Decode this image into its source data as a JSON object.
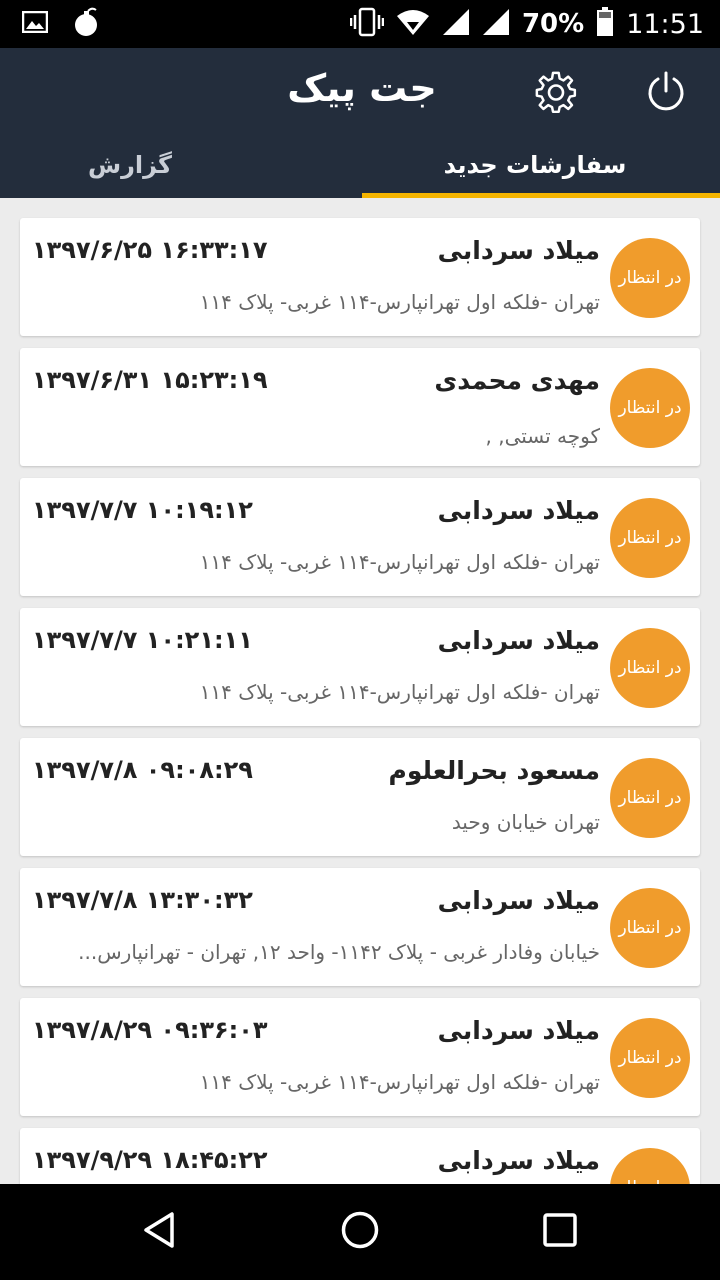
{
  "status_bar": {
    "battery": "70%",
    "time": "11:51"
  },
  "app": {
    "title": "جت پیک",
    "tabs": {
      "new_orders": "سفارشات جدید",
      "report": "گزارش"
    }
  },
  "orders": [
    {
      "status": "در انتظار",
      "name": "میلاد سردابی",
      "datetime": "۱۳۹۷/۶/۲۵ ۱۶:۳۳:۱۷",
      "address": "تهران -فلکه اول تهرانپارس-۱۱۴ غربی- پلاک ۱۱۴"
    },
    {
      "status": "در انتظار",
      "name": "مهدی محمدی",
      "datetime": "۱۳۹۷/۶/۳۱ ۱۵:۲۳:۱۹",
      "address": "کوچه تستی,  ,"
    },
    {
      "status": "در انتظار",
      "name": "میلاد سردابی",
      "datetime": "۱۳۹۷/۷/۷ ۱۰:۱۹:۱۲",
      "address": "تهران -فلکه اول تهرانپارس-۱۱۴ غربی- پلاک ۱۱۴"
    },
    {
      "status": "در انتظار",
      "name": "میلاد سردابی",
      "datetime": "۱۳۹۷/۷/۷ ۱۰:۲۱:۱۱",
      "address": "تهران -فلکه اول تهرانپارس-۱۱۴ غربی- پلاک ۱۱۴"
    },
    {
      "status": "در انتظار",
      "name": "مسعود بحرالعلوم",
      "datetime": "۱۳۹۷/۷/۸ ۰۹:۰۸:۲۹",
      "address": "تهران خیابان وحید"
    },
    {
      "status": "در انتظار",
      "name": "میلاد سردابی",
      "datetime": "۱۳۹۷/۷/۸ ۱۳:۳۰:۳۲",
      "address": "خیابان وفادار غربی - پلاک ۱۱۴۲- واحد ۱۲, تهران - تهرانپارس..."
    },
    {
      "status": "در انتظار",
      "name": "میلاد سردابی",
      "datetime": "۱۳۹۷/۸/۲۹ ۰۹:۳۶:۰۳",
      "address": "تهران -فلکه اول تهرانپارس-۱۱۴ غربی- پلاک ۱۱۴"
    },
    {
      "status": "در انتظار",
      "name": "میلاد سردابی",
      "datetime": "۱۳۹۷/۹/۲۹ ۱۸:۴۵:۲۲",
      "address": ""
    }
  ],
  "icons": {
    "status_left": [
      "image-icon",
      "bomb-icon"
    ],
    "status_right": [
      "vibrate-icon",
      "wifi-icon",
      "signal-icon",
      "signal-icon",
      "battery-icon"
    ],
    "app_bar": [
      "settings-gear-icon",
      "power-icon"
    ],
    "nav": [
      "back-icon",
      "home-icon",
      "recents-icon"
    ]
  },
  "colors": {
    "app_bar": "#232d3c",
    "tab_indicator": "#f4b400",
    "status_badge": "#f09c2c",
    "background": "#ececec"
  }
}
